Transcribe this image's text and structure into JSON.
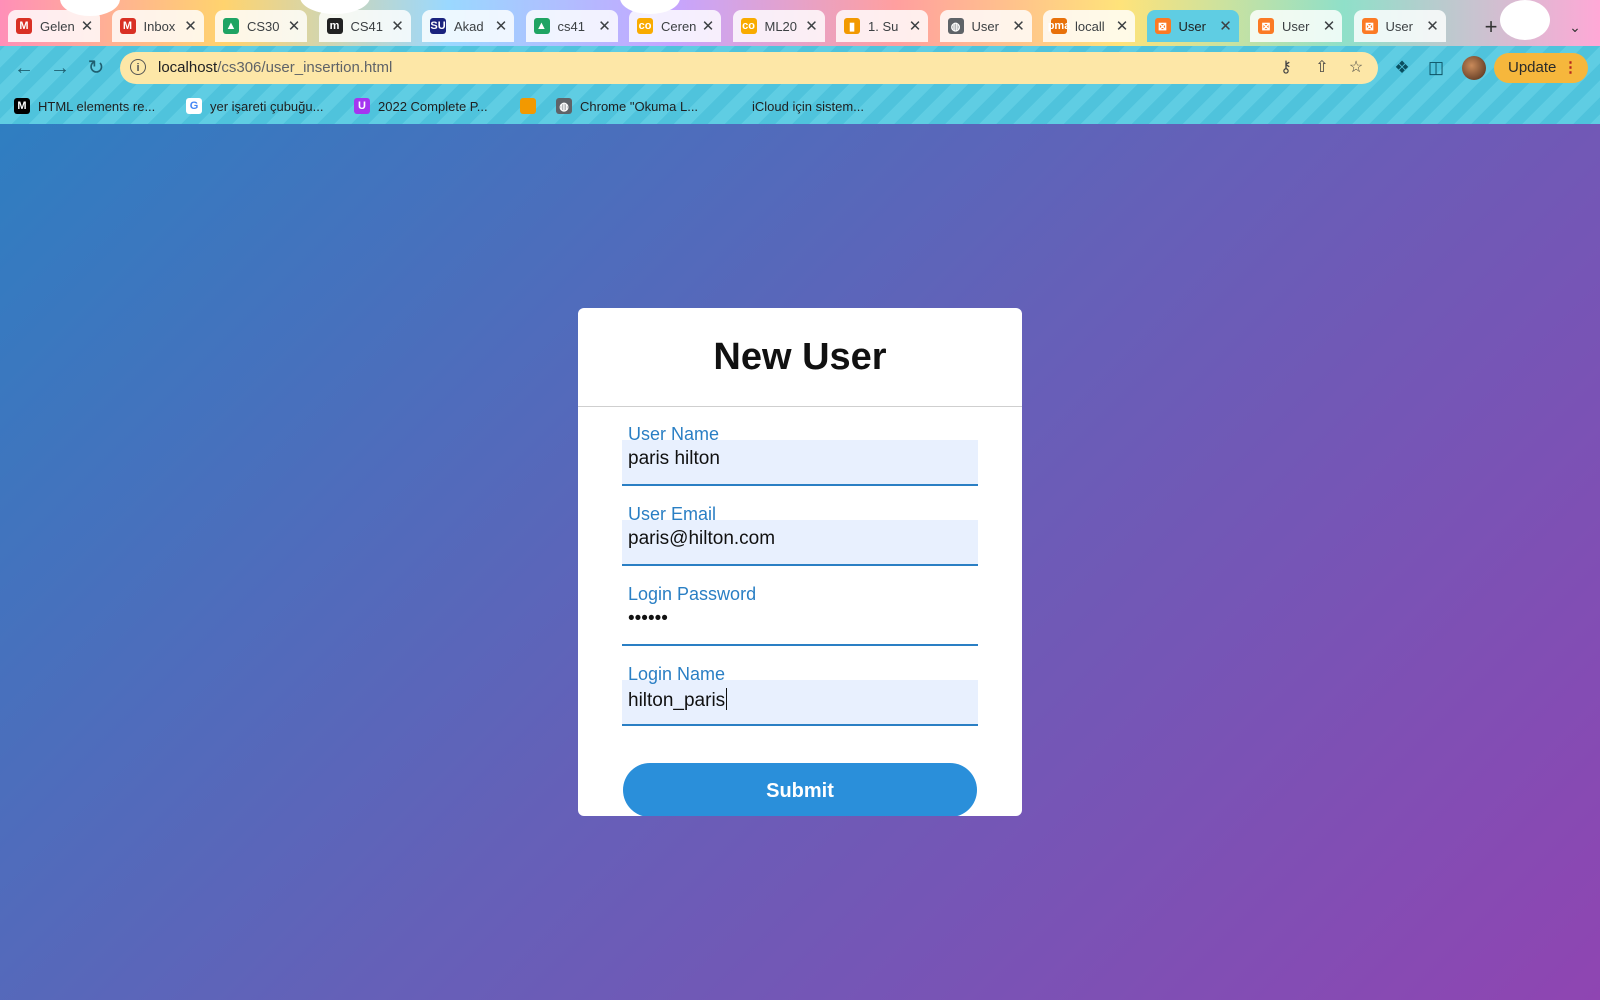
{
  "browser": {
    "tabs": [
      {
        "title": "Gelen",
        "icon": "gmail-icon",
        "color": "#d93025"
      },
      {
        "title": "Inbox",
        "icon": "gmail-icon",
        "color": "#d93025"
      },
      {
        "title": "CS30",
        "icon": "google-drive-icon",
        "color": "#1fa463"
      },
      {
        "title": "CS41",
        "icon": "medium-icon",
        "color": "#222222"
      },
      {
        "title": "Akad",
        "icon": "su-logo-icon",
        "color": "#1a237e"
      },
      {
        "title": "cs41",
        "icon": "google-drive-icon",
        "color": "#1fa463"
      },
      {
        "title": "Ceren",
        "icon": "colab-icon",
        "color": "#f9ab00"
      },
      {
        "title": "ML20",
        "icon": "colab-icon",
        "color": "#f9ab00"
      },
      {
        "title": "1. Su",
        "icon": "chart-icon",
        "color": "#f29900"
      },
      {
        "title": "User",
        "icon": "globe-icon",
        "color": "#5f6368"
      },
      {
        "title": "locall",
        "icon": "phpmyadmin-icon",
        "color": "#e8710a"
      },
      {
        "title": "User",
        "icon": "xampp-icon",
        "color": "#fb7a24",
        "active": true
      },
      {
        "title": "User",
        "icon": "xampp-icon",
        "color": "#fb7a24"
      },
      {
        "title": "User",
        "icon": "xampp-icon",
        "color": "#fb7a24"
      }
    ],
    "address": {
      "host": "localhost",
      "path": "/cs306/user_insertion.html"
    },
    "update_label": "Update",
    "bookmarks": [
      {
        "label": "HTML elements re...",
        "icon": "mdn-icon"
      },
      {
        "label": "yer işareti çubuğu...",
        "icon": "google-icon"
      },
      {
        "label": "2022 Complete P...",
        "icon": "udemy-icon"
      },
      {
        "label": "",
        "icon": "bookmark-folder-icon"
      },
      {
        "label": "Chrome \"Okuma L...",
        "icon": "globe-icon"
      },
      {
        "label": "iCloud için sistem...",
        "icon": "apple-icon"
      }
    ]
  },
  "form": {
    "title": "New User",
    "fields": [
      {
        "label": "User Name",
        "value": "paris hilton"
      },
      {
        "label": "User Email",
        "value": "paris@hilton.com"
      },
      {
        "label": "Login Password",
        "value": "••••••"
      },
      {
        "label": "Login Name",
        "value": "hilton_paris"
      }
    ],
    "submit_label": "Submit"
  },
  "colors": {
    "accent": "#2a8fda",
    "label": "#2a7fc4",
    "background_start": "#2f7ec1",
    "background_end": "#8f45b2"
  }
}
